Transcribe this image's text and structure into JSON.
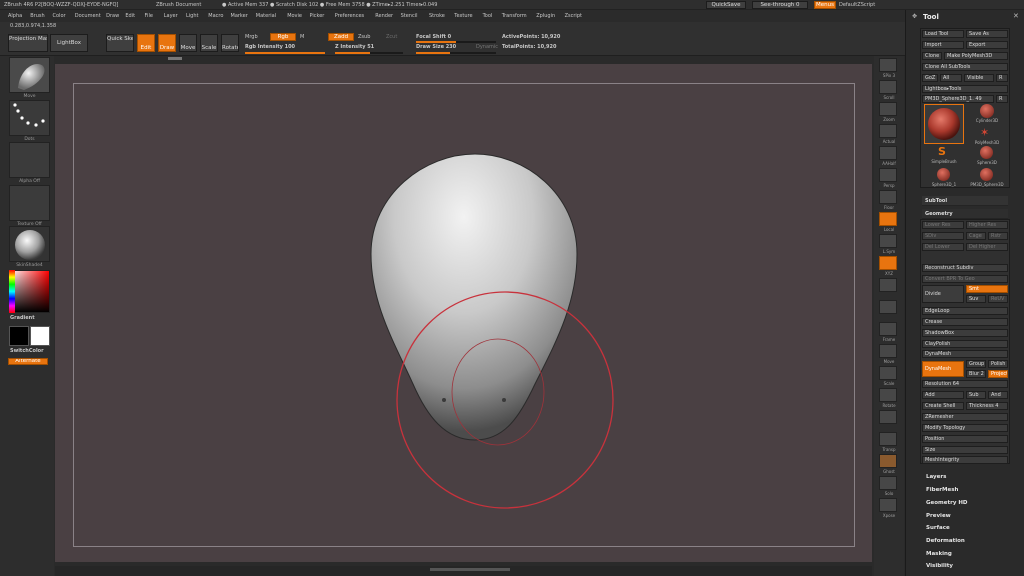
{
  "titlebar": {
    "app": "ZBrush 4R6 P2[BOQ-WZZF-QDXJ-EYDE-NGFQ]",
    "document": "ZBrush Document",
    "memory": "● Active Mem 337 ● Scratch Disk 102 ● Free Mem 3758 ● ZTime▸2.251 Timer▸0.049",
    "quicksave": "QuickSave",
    "see_through": "See-through 0",
    "menus_btn": "Menus",
    "script": "DefaultZScript"
  },
  "menubar": {
    "items": [
      "Alpha",
      "Brush",
      "Color",
      "Document",
      "Draw",
      "Edit",
      "File",
      "Layer",
      "Light",
      "Macro",
      "Marker",
      "Material",
      "Movie",
      "Picker",
      "Preferences",
      "Render",
      "Stencil",
      "Stroke",
      "Texture",
      "Tool",
      "Transform",
      "Zplugin",
      "Zscript"
    ]
  },
  "coords": "0.283,0.974,1.358",
  "toolbar": {
    "projection_master": "Projection Master",
    "lightbox": "LightBox",
    "quick_sketch": "Quick Sketch",
    "edit": "Edit",
    "draw": "Draw",
    "move": "Move",
    "scale": "Scale",
    "rotate": "Rotate",
    "mrgb": "Mrgb",
    "rgb": "Rgb",
    "m": "M",
    "zadd": "Zadd",
    "zsub": "Zsub",
    "zcut": "Zcut",
    "rgb_intensity": "Rgb Intensity 100",
    "z_intensity": "Z Intensity 51",
    "focal_shift": "Focal Shift 0",
    "draw_size": "Draw Size 230",
    "dynamic": "Dynamic",
    "active_points": "ActivePoints: 10,920",
    "total_points": "TotalPoints: 10,920",
    "rgb_intensity_value": 100,
    "z_intensity_value": 51,
    "draw_size_value": 230
  },
  "leftshelf": {
    "brush_label": "Move",
    "stroke_label": "Dots",
    "alpha_label": "Alpha Off",
    "texture_label": "Texture Off",
    "material_label": "SkinShade4",
    "gradient": "Gradient",
    "switch_color": "SwitchColor",
    "alternate": "Alternate"
  },
  "rightshelf": {
    "items": [
      "SPix 3",
      "Scroll",
      "Zoom",
      "Actual",
      "AAHalf",
      "Persp",
      "Floor",
      "Local",
      "L.Sym",
      "XYZ",
      "",
      "",
      "Frame",
      "Move",
      "Scale",
      "Rotate",
      "",
      "Transp",
      "Ghost",
      "Solo",
      "Xpose"
    ]
  },
  "toolpanel": {
    "title": "Tool",
    "load_tool": "Load Tool",
    "save_as": "Save As",
    "import": "Import",
    "export": "Export",
    "clone": "Clone",
    "make_polymesh": "Make PolyMesh3D",
    "clone_all": "Clone All SubTools",
    "goz": "GoZ",
    "all": "All",
    "visible": "Visible",
    "r": "R",
    "lightbox_tools": "Lightbox▸Tools",
    "current_tool": "PM3D_Sphere3D_1. 49",
    "tools": [
      "PM3D_Sphere3D_1",
      "Cylinder3D",
      "PolyMesh3D",
      "SimpleBrush",
      "Sphere3D",
      "Sphere3D_1",
      "PM3D_Sphere3D"
    ],
    "subtool": "SubTool",
    "geometry": "Geometry",
    "lower_res": "Lower Res",
    "higher_res": "Higher Res",
    "sdiv": "SDiv",
    "cage": "Cage",
    "rstr": "Rstr",
    "del_lower": "Del Lower",
    "del_higher": "Del Higher",
    "reconstruct_subdiv": "Reconstruct Subdiv",
    "convert_bpr": "Convert BPR To Geo",
    "divide": "Divide",
    "smt": "Smt",
    "suv": "Suv",
    "reuv": "ReUV",
    "edgeloop": "EdgeLoop",
    "crease": "Crease",
    "shadowbox": "ShadowBox",
    "claypolish": "ClayPolish",
    "dynamesh_section": "DynaMesh",
    "dynamesh_btn": "DynaMesh",
    "group": "Group",
    "polish": "Polish",
    "blur": "Blur 2",
    "project": "Project",
    "resolution": "Resolution 64",
    "add": "Add",
    "sub": "Sub",
    "and": "And",
    "create_shell": "Create Shell",
    "thickness": "Thickness 4",
    "zremesher": "ZRemesher",
    "modify_topology": "Modify Topology",
    "position": "Position",
    "size": "Size",
    "meshintegrity": "MeshIntegrity",
    "layers": "Layers",
    "fibermesh": "FiberMesh",
    "geometry_hd": "Geometry HD",
    "preview": "Preview",
    "surface": "Surface",
    "deformation": "Deformation",
    "masking": "Masking",
    "visibility": "Visibility"
  },
  "colors": {
    "accent": "#e8740f",
    "viewport": "#4a4043",
    "brush_ring": "#c8323c"
  }
}
